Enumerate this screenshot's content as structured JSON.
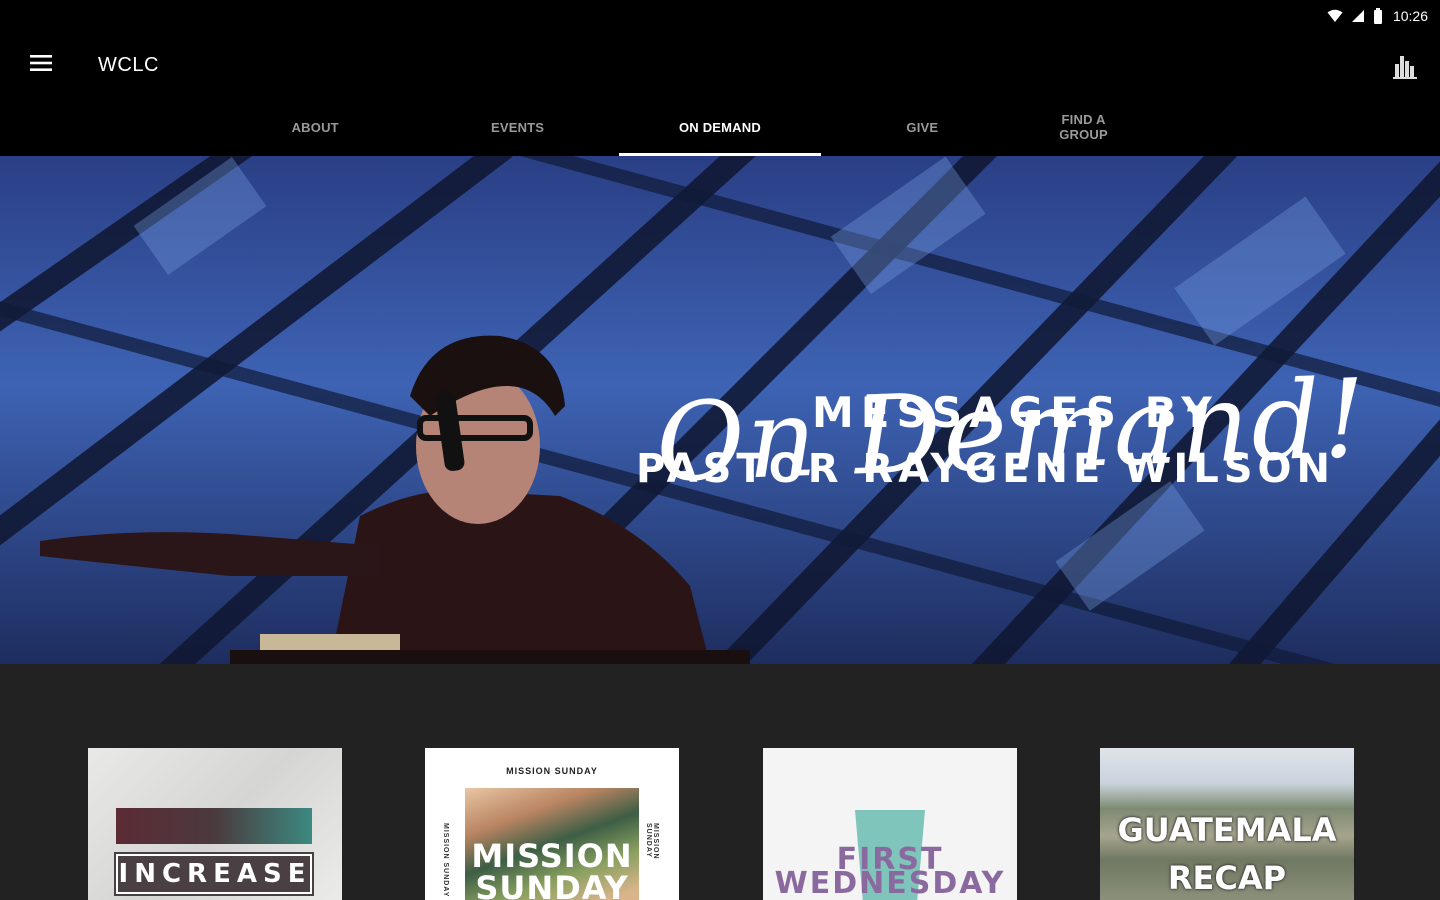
{
  "status_bar": {
    "time": "10:26"
  },
  "app_bar": {
    "title": "WCLC"
  },
  "tabs": [
    {
      "label": "ABOUT",
      "active": false
    },
    {
      "label": "EVENTS",
      "active": false
    },
    {
      "label": "ON DEMAND",
      "active": true
    },
    {
      "label": "GIVE",
      "active": false
    },
    {
      "label": "FIND A GROUP",
      "active": false
    }
  ],
  "hero": {
    "script_title": "On Demand!",
    "line1": "MESSAGES BY",
    "line2": "PASTOR RAYGENE WILSON"
  },
  "cards": [
    {
      "label": "INCREASE"
    },
    {
      "label": "MISSION SUNDAY",
      "top_text": "MISSION SUNDAY",
      "side_text": "MISSION SUNDAY"
    },
    {
      "label": "FIRST WEDNESDAY"
    },
    {
      "label": "GUATEMALA RECAP"
    }
  ],
  "colors": {
    "background": "#000000",
    "content_background": "#222222",
    "tab_inactive": "#9a9a9a",
    "tab_active": "#ffffff"
  }
}
